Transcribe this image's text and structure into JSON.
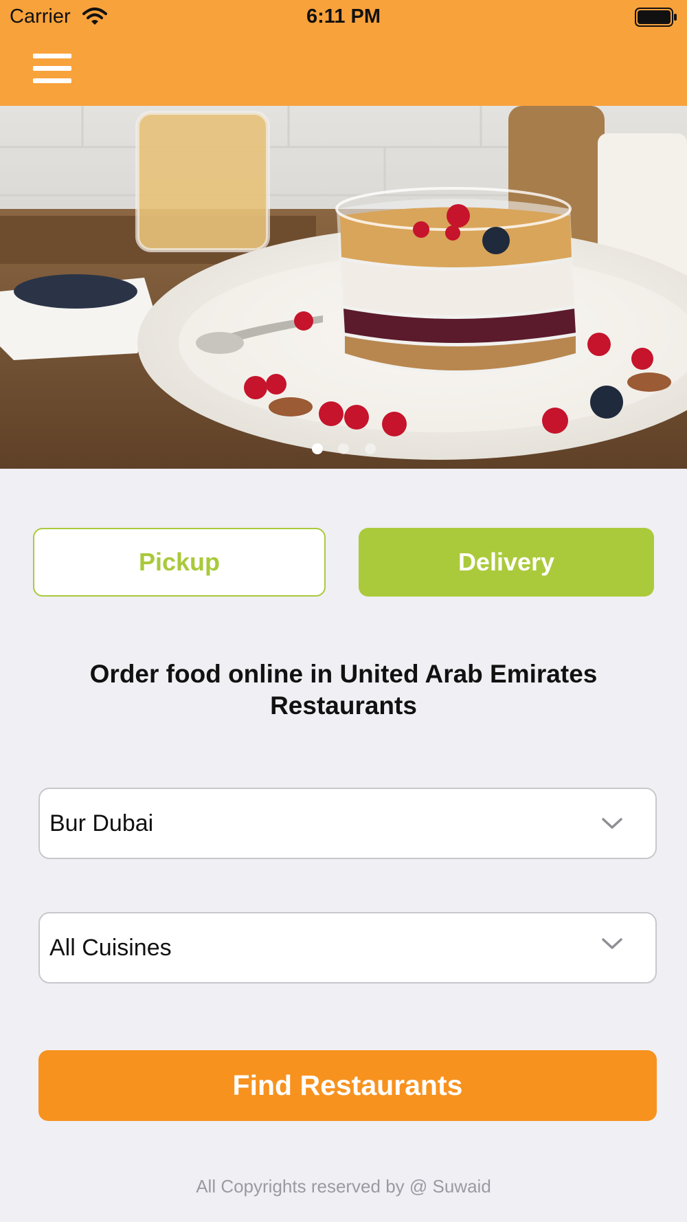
{
  "status_bar": {
    "carrier": "Carrier",
    "time": "6:11 PM"
  },
  "colors": {
    "header_bg": "#f8a23c",
    "accent_green": "#abca3b",
    "find_button": "#f7921f",
    "background": "#efeff4"
  },
  "header": {
    "menu_icon": "hamburger-menu-icon"
  },
  "carousel": {
    "page_count": 3,
    "active_page": 1
  },
  "mode_toggle": {
    "pickup_label": "Pickup",
    "delivery_label": "Delivery",
    "selected": "Delivery"
  },
  "heading": "Order food online in United Arab Emirates Restaurants",
  "filters": {
    "location": "Bur Dubai",
    "cuisine": "All Cuisines"
  },
  "find_button_label": "Find Restaurants",
  "footer": {
    "copyright": "All Copyrights reserved by @ Suwaid"
  }
}
